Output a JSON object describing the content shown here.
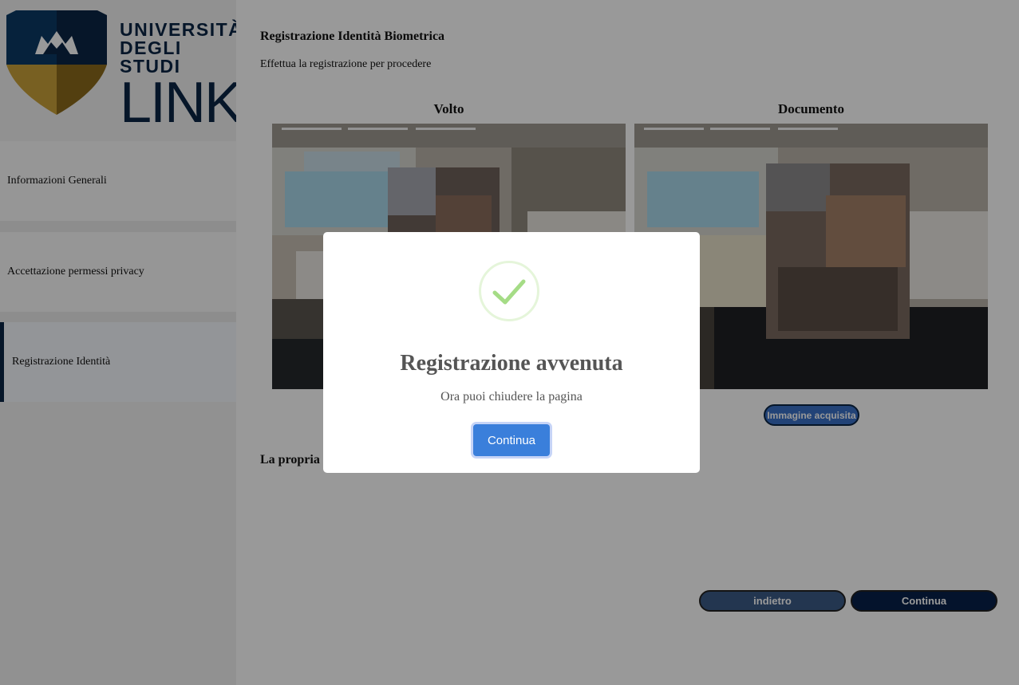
{
  "brand": {
    "line1": "UNIVERSITÀ",
    "line2": "DEGLI STUDI",
    "line3": "LINK",
    "colors": {
      "navy": "#0b2545",
      "gold": "#b8922a"
    }
  },
  "sidebar": {
    "items": [
      {
        "label": "Informazioni Generali",
        "active": false
      },
      {
        "label": "Accettazione permessi privacy",
        "active": false
      },
      {
        "label": "Registrazione Identità",
        "active": true
      }
    ]
  },
  "main": {
    "title": "Registrazione Identità Biometrica",
    "subtitle": "Effettua la registrazione per procedere",
    "columns": [
      {
        "label": "Volto"
      },
      {
        "label": "Documento"
      }
    ],
    "status_label": "Immagine acquisita",
    "notice": "La propria identità è registrata tramite la rilevazione dell'ambiente e del volto.",
    "back_button": "indietro",
    "next_button": "Continua"
  },
  "modal": {
    "icon": "check-icon",
    "title": "Registrazione avvenuta",
    "text": "Ora puoi chiudere la pagina",
    "button": "Continua"
  }
}
